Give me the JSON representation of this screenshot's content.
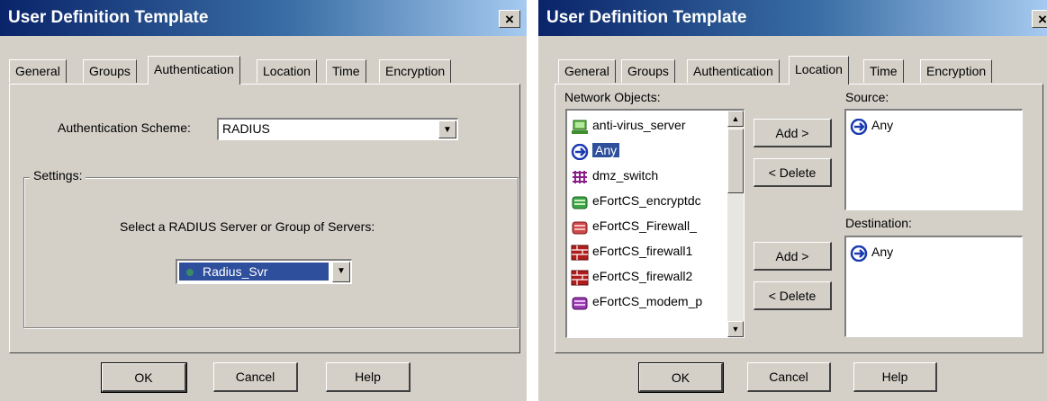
{
  "dialog1": {
    "title": "User Definition Template",
    "close": "×",
    "tabs": [
      "General",
      "Groups",
      "Authentication",
      "Location",
      "Time",
      "Encryption"
    ],
    "active_tab": "Authentication",
    "scheme_label": "Authentication Scheme:",
    "scheme_value": "RADIUS",
    "settings_label": "Settings:",
    "server_prompt": "Select a RADIUS Server or Group of Servers:",
    "server_value": "Radius_Svr",
    "buttons": {
      "ok": "OK",
      "cancel": "Cancel",
      "help": "Help"
    }
  },
  "dialog2": {
    "title": "User Definition Template",
    "close": "×",
    "tabs": [
      "General",
      "Groups",
      "Authentication",
      "Location",
      "Time",
      "Encryption"
    ],
    "active_tab": "Location",
    "network_objects_label": "Network Objects:",
    "network_objects": [
      {
        "label": "anti-virus_server",
        "icon": "server-icon"
      },
      {
        "label": "Any",
        "icon": "any-icon",
        "selected": true
      },
      {
        "label": "dmz_switch",
        "icon": "switch-icon"
      },
      {
        "label": "eFortCS_encryptdc",
        "icon": "gateway-icon"
      },
      {
        "label": "eFortCS_Firewall_",
        "icon": "gateway-icon"
      },
      {
        "label": "eFortCS_firewall1",
        "icon": "firewall-icon"
      },
      {
        "label": "eFortCS_firewall2",
        "icon": "firewall-icon"
      },
      {
        "label": "eFortCS_modem_p",
        "icon": "gateway-icon"
      }
    ],
    "source_label": "Source:",
    "source_items": [
      "Any"
    ],
    "destination_label": "Destination:",
    "destination_items": [
      "Any"
    ],
    "add_label": "Add >",
    "delete_label": "< Delete",
    "buttons": {
      "ok": "OK",
      "cancel": "Cancel",
      "help": "Help"
    }
  },
  "colors": {
    "titlebar_start": "#0a246a",
    "titlebar_end": "#a6caf0",
    "selection": "#2e4f9c",
    "face": "#d4d0c8"
  }
}
